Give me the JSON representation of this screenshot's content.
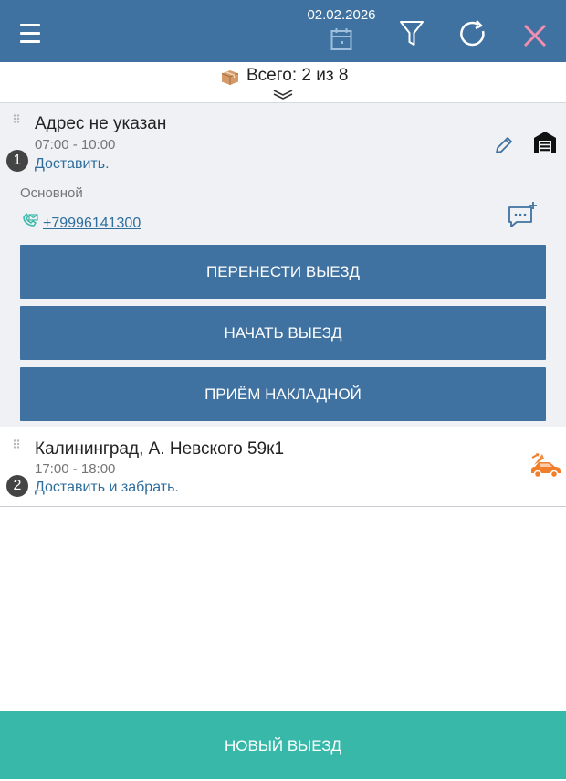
{
  "header": {
    "date": "02.02.2026",
    "icons": [
      "menu-icon",
      "calendar-icon",
      "filter-icon",
      "refresh-icon",
      "close-icon"
    ]
  },
  "summary": {
    "text": "Всего: 2 из 8",
    "icon": "package-icon"
  },
  "visits": [
    {
      "number": "1",
      "address": "Адрес не указан",
      "time": "07:00 - 10:00",
      "action": "Доставить.",
      "contact_label": "Основной",
      "phone": "+79996141300",
      "icons": [
        "drag-handle-icon",
        "edit-icon",
        "warehouse-icon",
        "phone-icon",
        "add-comment-icon"
      ],
      "buttons": [
        "ПЕРЕНЕСТИ ВЫЕЗД",
        "НАЧАТЬ ВЫЕЗД",
        "ПРИЁМ НАКЛАДНОЙ"
      ]
    },
    {
      "number": "2",
      "address": "Калининград, А. Невского 59к1",
      "time": "17:00 - 18:00",
      "action": "Доставить и забрать.",
      "icons": [
        "drag-handle-icon",
        "delivery-car-icon"
      ]
    }
  ],
  "footer": {
    "new_visit_label": "НОВЫЙ ВЫЕЗД"
  },
  "colors": {
    "header": "#3f72a0",
    "button": "#3f72a0",
    "footer": "#38b8a8",
    "link": "#2e6d9c",
    "close": "#f08fb0",
    "car": "#f07e2b"
  }
}
